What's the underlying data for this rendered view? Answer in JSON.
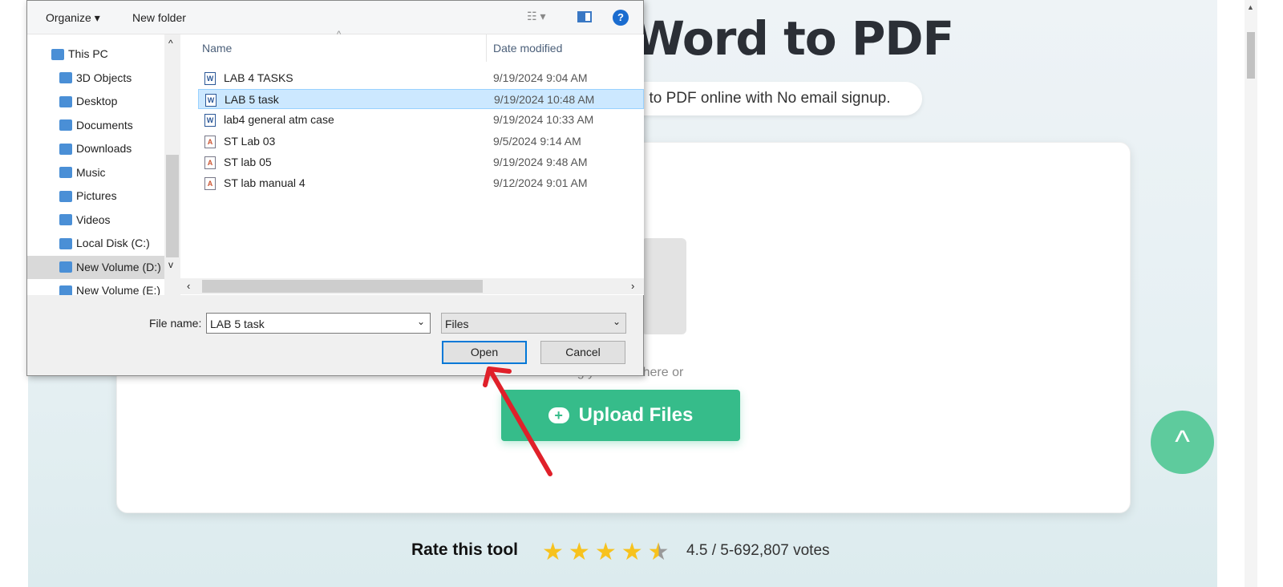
{
  "page": {
    "title": "Word to PDF",
    "subtitle": "l to PDF online with No email signup.",
    "drag_text": "Drag your files here or",
    "upload_label": "Upload Files",
    "rate_label": "Rate this tool",
    "rating": 4.5,
    "votes_text": "4.5 / 5-692,807 votes",
    "accent": "#36bc8a"
  },
  "dialog": {
    "toolbar": {
      "organize": "Organize ▾",
      "new_folder": "New folder",
      "view": "☷ ▾",
      "help": "?"
    },
    "nav": [
      {
        "label": "This PC",
        "icon": "pc-icon"
      },
      {
        "label": "3D Objects",
        "icon": "cube-icon"
      },
      {
        "label": "Desktop",
        "icon": "desktop-icon"
      },
      {
        "label": "Documents",
        "icon": "document-icon"
      },
      {
        "label": "Downloads",
        "icon": "download-icon"
      },
      {
        "label": "Music",
        "icon": "music-icon"
      },
      {
        "label": "Pictures",
        "icon": "picture-icon"
      },
      {
        "label": "Videos",
        "icon": "video-icon"
      },
      {
        "label": "Local Disk (C:)",
        "icon": "disk-icon"
      },
      {
        "label": "New Volume (D:)",
        "icon": "disk-icon",
        "selected": true
      },
      {
        "label": "New Volume (E:)",
        "icon": "disk-icon"
      }
    ],
    "columns": {
      "name": "Name",
      "date": "Date modified"
    },
    "files": [
      {
        "name": "LAB 4 TASKS",
        "date": "9/19/2024 9:04 AM",
        "type": "word"
      },
      {
        "name": "LAB 5 task",
        "date": "9/19/2024 10:48 AM",
        "type": "word",
        "selected": true
      },
      {
        "name": "lab4 general atm case",
        "date": "9/19/2024 10:33 AM",
        "type": "word"
      },
      {
        "name": "ST Lab 03",
        "date": "9/5/2024 9:14 AM",
        "type": "text"
      },
      {
        "name": "ST lab 05",
        "date": "9/19/2024 9:48 AM",
        "type": "text"
      },
      {
        "name": "ST lab manual 4",
        "date": "9/12/2024 9:01 AM",
        "type": "text"
      }
    ],
    "file_name_label": "File name:",
    "file_name_value": "LAB 5 task",
    "file_type": "Files",
    "open_label": "Open",
    "cancel_label": "Cancel"
  }
}
